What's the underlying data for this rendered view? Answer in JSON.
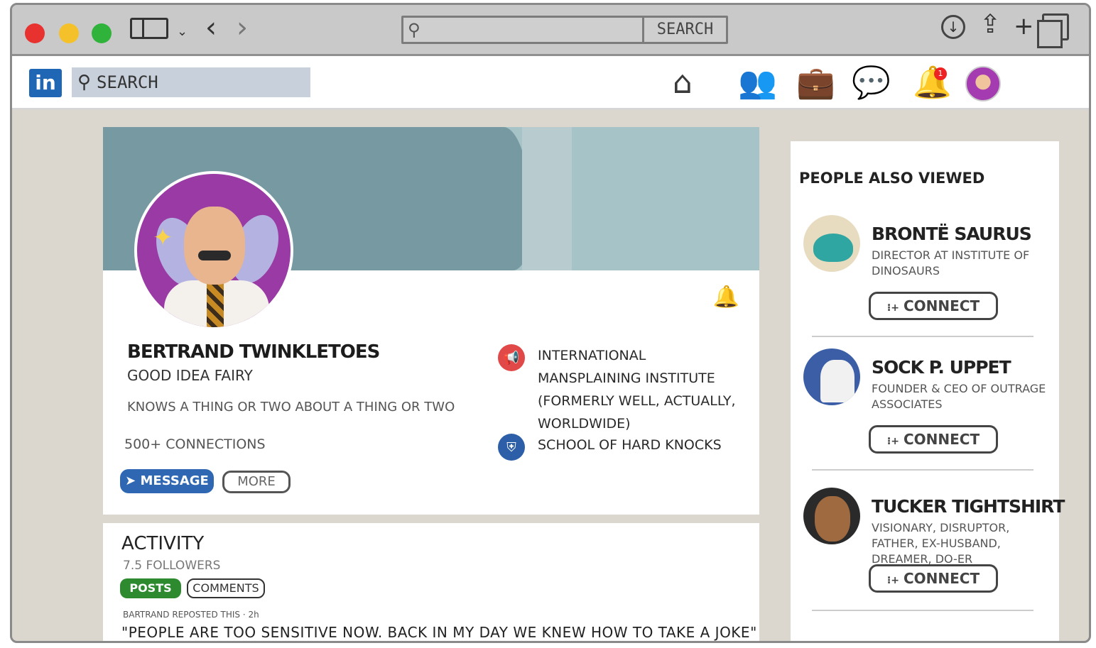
{
  "browser": {
    "address_button": "SEARCH"
  },
  "topbar": {
    "logo": "in",
    "search_placeholder": "SEARCH",
    "notification_count": "1"
  },
  "profile": {
    "name": "BERTRAND TWINKLETOES",
    "title": "GOOD IDEA FAIRY",
    "about": "KNOWS A THING OR TWO ABOUT A THING OR TWO",
    "connections": "500+ CONNECTIONS",
    "message_label": "MESSAGE",
    "more_label": "MORE",
    "company": "INTERNATIONAL MANSPLAINING INSTITUTE (FORMERLY WELL, ACTUALLY, WORLDWIDE)",
    "school": "SCHOOL OF HARD KNOCKS"
  },
  "activity": {
    "title": "ACTIVITY",
    "followers": "7.5 FOLLOWERS",
    "posts_label": "POSTS",
    "comments_label": "COMMENTS",
    "repost_meta": "BARTRAND REPOSTED THIS · 2h",
    "repost_text": "\"PEOPLE ARE TOO SENSITIVE NOW. BACK IN MY DAY WE KNEW HOW TO TAKE A JOKE\""
  },
  "sidebar": {
    "title": "PEOPLE ALSO VIEWED",
    "connect_label": "CONNECT",
    "people": [
      {
        "name": "BRONTË SAURUS",
        "desc": "DIRECTOR AT INSTITUTE OF DINOSAURS"
      },
      {
        "name": "SOCK P. UPPET",
        "desc": "FOUNDER & CEO OF OUTRAGE ASSOCIATES"
      },
      {
        "name": "TUCKER TIGHTSHIRT",
        "desc": "VISIONARY, DISRUPTOR, FATHER, EX-HUSBAND, DREAMER, DO-ER"
      }
    ]
  },
  "colors": {
    "linkedin_blue": "#1f66b5",
    "message_blue": "#2f67b3",
    "posts_green": "#2d8a2f",
    "cover_dark": "#779aa2",
    "cover_light": "#a6c3c7",
    "page_bg": "#dcd7ce"
  },
  "icons": [
    "search-icon",
    "home-icon",
    "people-icon",
    "briefcase-icon",
    "chat-icon",
    "bell-icon",
    "send-icon",
    "shield-icon",
    "megaphone-icon",
    "add-person-icon",
    "download-icon",
    "share-icon",
    "plus-icon",
    "tabs-icon",
    "sidebar-icon",
    "back-icon",
    "forward-icon"
  ]
}
